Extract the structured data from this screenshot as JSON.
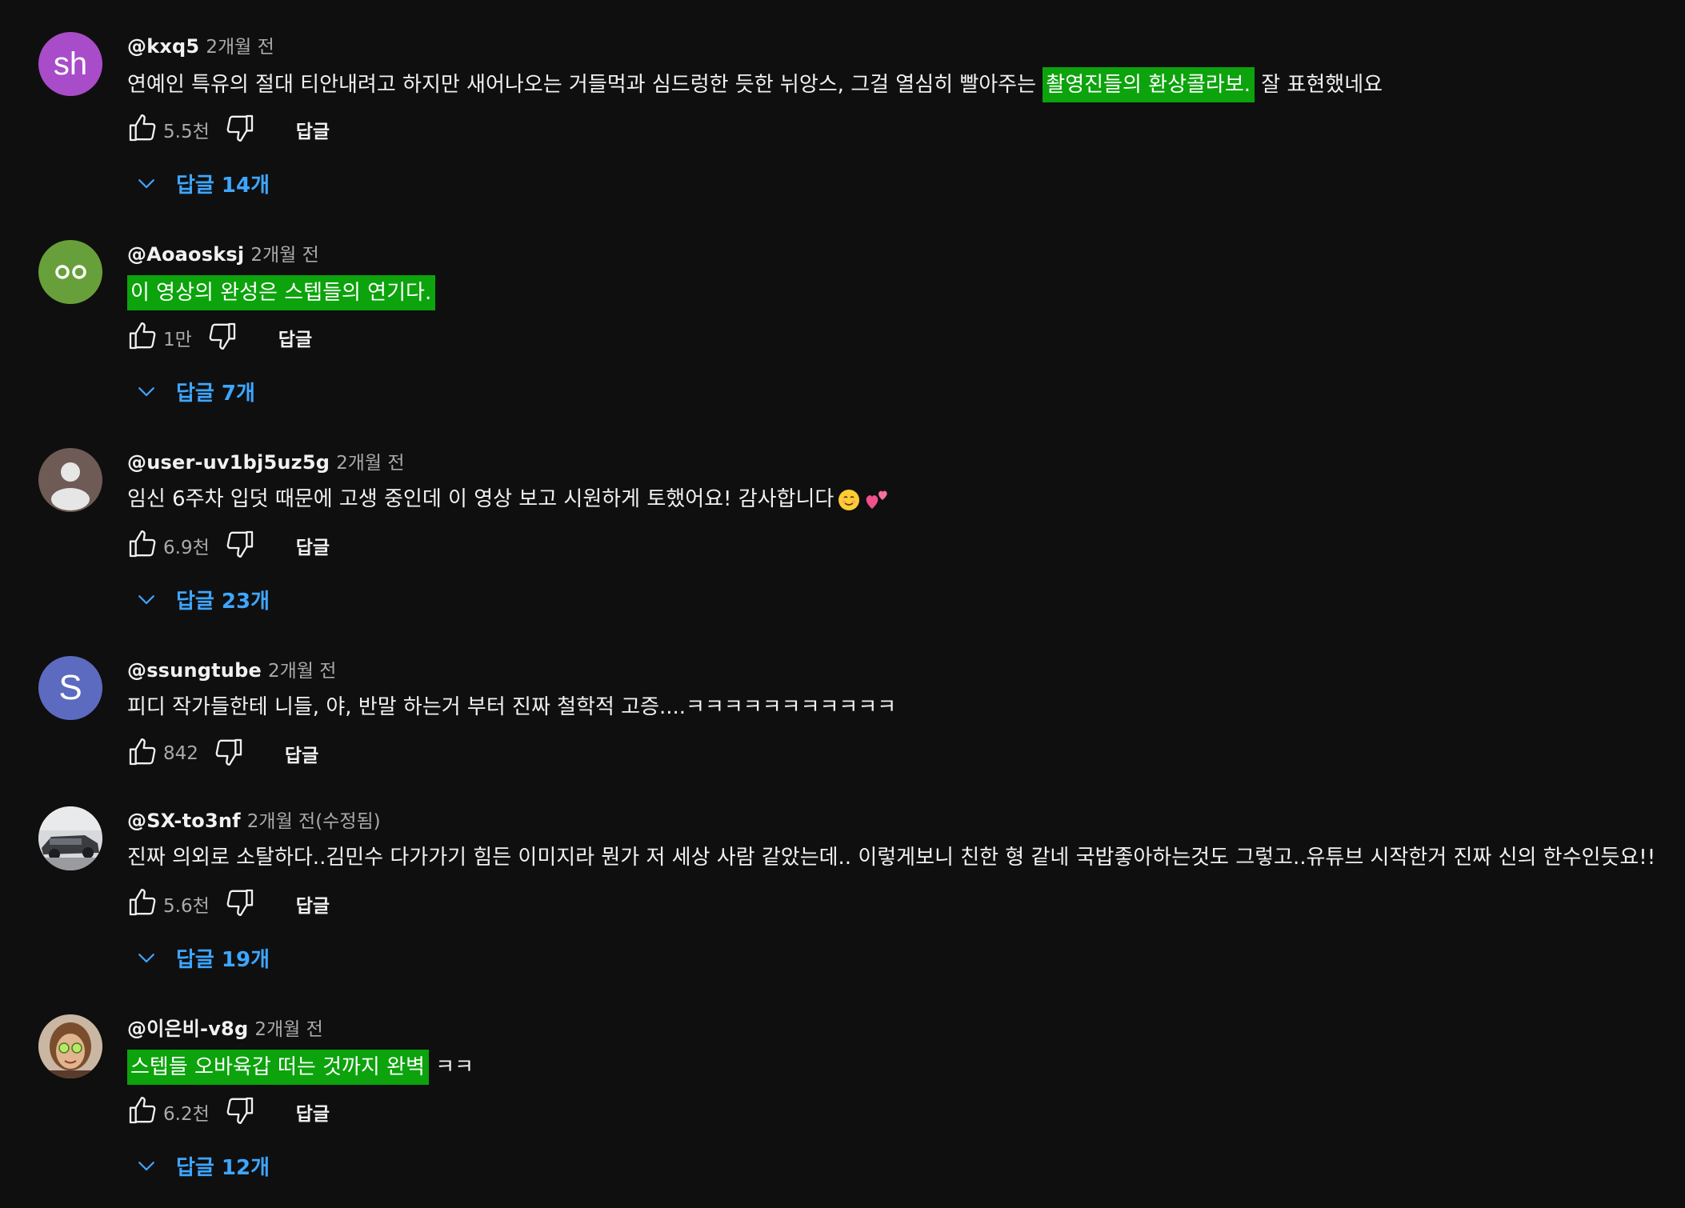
{
  "ui": {
    "reply_button_label": "답글"
  },
  "comments": [
    {
      "avatar": {
        "type": "letters",
        "letters": "sh",
        "color": "#a84cc9"
      },
      "author": "@kxq5",
      "time": "2개월 전",
      "text_parts": [
        {
          "t": "연예인 특유의 절대 티안내려고 하지만 새어나오는 거들먹과 심드렁한 듯한 뉘앙스, 그걸 열심히 빨아주는 "
        },
        {
          "t": "촬영진들의 환상콜라보.",
          "hl": true
        },
        {
          "t": " 잘 표현했네요"
        }
      ],
      "likes": "5.5천",
      "replies": "답글 14개"
    },
    {
      "avatar": {
        "type": "eyes",
        "color": "#67a03a"
      },
      "author": "@Aoaosksj",
      "time": "2개월 전",
      "text_parts": [
        {
          "t": "이 영상의 완성은 스텝들의 연기다.",
          "hl": true
        }
      ],
      "likes": "1만",
      "replies": "답글 7개"
    },
    {
      "avatar": {
        "type": "default-user",
        "color": "#6e5b55"
      },
      "author": "@user-uv1bj5uz5g",
      "time": "2개월 전",
      "text_parts": [
        {
          "t": "임신 6주차 입덧 때문에 고생 중인데 이 영상 보고 시원하게 토했어요! 감사합니다"
        }
      ],
      "emojis": [
        "smiling-face-emoji",
        "two-hearts-emoji"
      ],
      "likes": "6.9천",
      "replies": "답글 23개"
    },
    {
      "avatar": {
        "type": "letters",
        "letters": "S",
        "color": "#5c6bc0"
      },
      "author": "@ssungtube",
      "time": "2개월 전",
      "text_parts": [
        {
          "t": "피디 작가들한테 니들, 야, 반말 하는거 부터 진짜 철학적 고증....ㅋㅋㅋㅋㅋㅋㅋㅋㅋㅋㅋ"
        }
      ],
      "likes": "842",
      "replies": ""
    },
    {
      "avatar": {
        "type": "car-photo",
        "color": "#6b6e73"
      },
      "author": "@SX-to3nf",
      "time": "2개월 전(수정됨)",
      "text_parts": [
        {
          "t": "진짜 의외로 소탈하다..김민수 다가가기 힘든 이미지라 뭔가 저 세상 사람 같았는데.. 이렇게보니 친한 형 같네 국밥좋아하는것도 그렇고..유튜브 시작한거 진짜 신의 한수인듯요!!"
        }
      ],
      "likes": "5.6천",
      "replies": "답글 19개"
    },
    {
      "avatar": {
        "type": "person-photo",
        "color": "#8a6a50"
      },
      "author": "@이은비-v8g",
      "time": "2개월 전",
      "text_parts": [
        {
          "t": "스텝들 오바육갑 떠는 것까지 완벽",
          "hl": true
        },
        {
          "t": " ㅋㅋ"
        }
      ],
      "likes": "6.2천",
      "replies": "답글 12개"
    }
  ]
}
